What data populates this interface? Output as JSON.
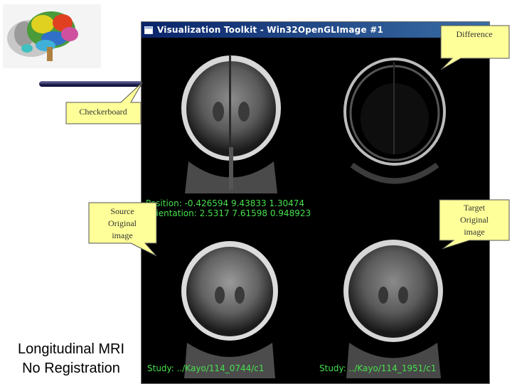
{
  "window": {
    "title": "Visualization Toolkit - Win32OpenGLImage #1",
    "position_text": "Position:  -0.426594 9.43833 1.30474",
    "orientation_text": "Orientation:  2.5317 7.61598 0.948923",
    "study_left": "Study: ../Kayo/114_0744/c1",
    "study_right": "Study: ../Kayo/114_1951/c1"
  },
  "callouts": {
    "difference": "Difference",
    "checkerboard": "Checkerboard",
    "source": [
      "Source",
      "Original",
      "image"
    ],
    "target": [
      "Target",
      "Original",
      "image"
    ]
  },
  "caption": {
    "line1": "Longitudinal MRI",
    "line2": "No Registration"
  },
  "colors": {
    "callout_fill": "#ffff99",
    "overlay_text": "#46e04c",
    "title_bar": "#0a246a"
  },
  "icons": {
    "logo": "brain-logo-icon",
    "window": "window-icon"
  }
}
